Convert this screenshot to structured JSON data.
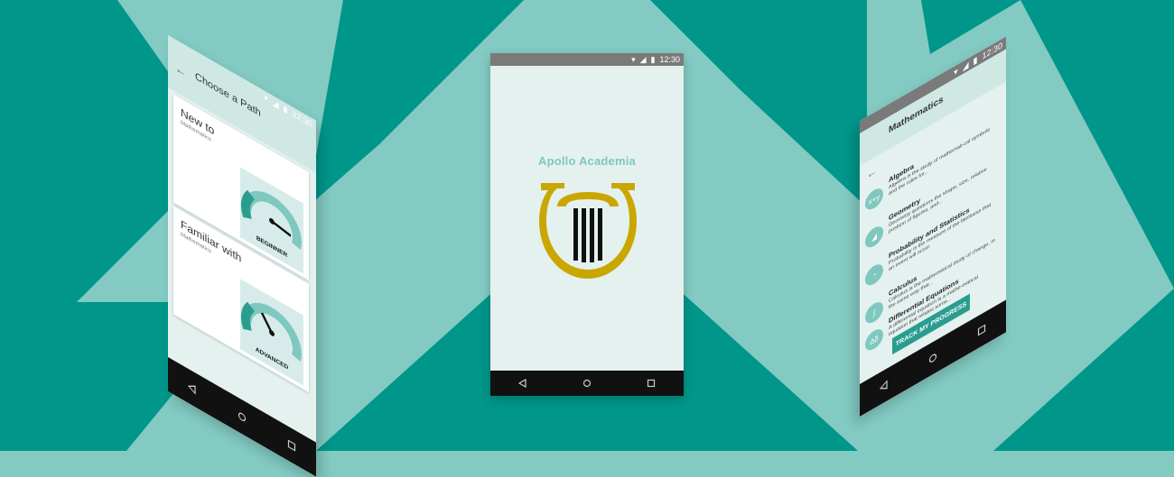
{
  "status": {
    "time": "12:30"
  },
  "center_phone": {
    "app_name": "Apollo Academia",
    "logo_icon": "lyre-logo",
    "colors": {
      "logo_gold": "#c9a700",
      "stripes": "#111111",
      "app_name": "#7ec8c0"
    }
  },
  "left_phone": {
    "title": "Choose a Path",
    "cards": [
      {
        "title": "New to",
        "subtitle": "Mathematics",
        "gauge_label": "BEGINNER"
      },
      {
        "title": "Familiar with",
        "subtitle": "Mathematics",
        "gauge_label": "ADVANCED"
      }
    ]
  },
  "right_phone": {
    "title": "Mathematics",
    "topics": [
      {
        "title": "Algebra",
        "desc": "Algebra is the study of mathemati-cal symbols and the rules for...",
        "icon": "x+y",
        "icon_name": "algebra-icon"
      },
      {
        "title": "Geometry",
        "desc": "Geometry questions the shape, size, relative position of figures, and...",
        "icon": "◢",
        "icon_name": "geometry-icon"
      },
      {
        "title": "Probability and Statistics",
        "desc": "Probability is the measure of the likeliness that an event will occur.",
        "icon": "◔",
        "icon_name": "probability-icon"
      },
      {
        "title": "Calculus",
        "desc": "Calculus is the mathematical study of change, in the same way that...",
        "icon": "∫",
        "icon_name": "calculus-icon"
      },
      {
        "title": "Differential Equations",
        "desc": "A differential equation is a mathe-matical equation that relates some...",
        "icon": "∆δ",
        "icon_name": "differential-icon"
      }
    ],
    "button_label": "TRACK MY PROGRESS"
  },
  "colors": {
    "bg_dark": "#00968a",
    "bg_light": "#82cac2",
    "accent": "#2a9d8f"
  }
}
